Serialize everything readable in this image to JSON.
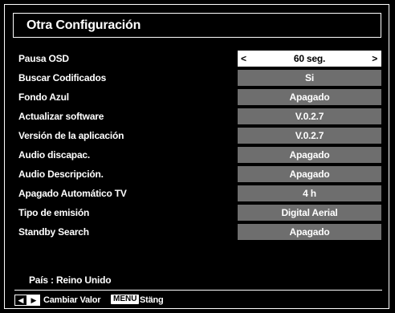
{
  "header": {
    "title": "Otra Configuración"
  },
  "settings": [
    {
      "label": "Pausa OSD",
      "value": "60 seg.",
      "selected": true
    },
    {
      "label": "Buscar Codificados",
      "value": "Si"
    },
    {
      "label": "Fondo Azul",
      "value": "Apagado"
    },
    {
      "label": "Actualizar software",
      "value": "V.0.2.7"
    },
    {
      "label": "Versión de la aplicación",
      "value": "V.0.2.7"
    },
    {
      "label": "Audio discapac.",
      "value": "Apagado"
    },
    {
      "label": "Audio Descripción.",
      "value": "Apagado"
    },
    {
      "label": "Apagado Automático TV",
      "value": "4 h"
    },
    {
      "label": "Tipo de emisión",
      "value": "Digital Aerial"
    },
    {
      "label": "Standby Search",
      "value": "Apagado"
    }
  ],
  "status": {
    "country": "País : Reino Unido"
  },
  "footer": {
    "change_value_label": "Cambiar Valor",
    "menu_key": "MENU",
    "close_label": "Stäng"
  },
  "arrows": {
    "left": "<",
    "right": ">"
  }
}
